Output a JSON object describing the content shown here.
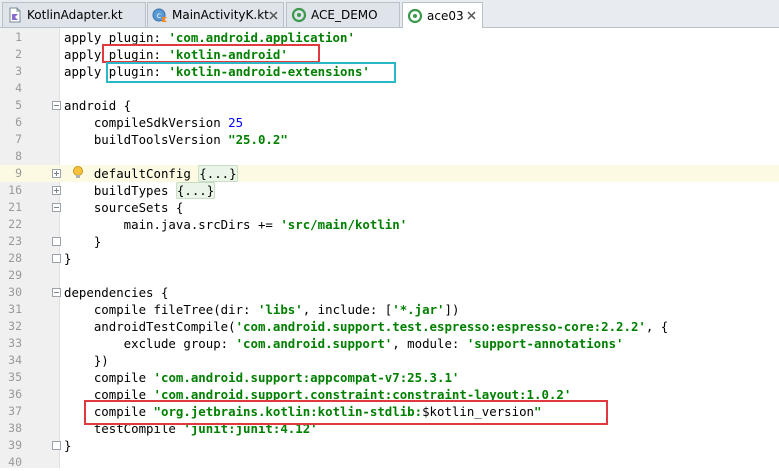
{
  "tabs": [
    {
      "label": "KotlinAdapter.kt",
      "icon": "kotlin-file-icon",
      "active": false
    },
    {
      "label": "MainActivityK.kt",
      "icon": "kotlin-class-icon",
      "active": false
    },
    {
      "label": "ACE_DEMO",
      "icon": "android-module-icon",
      "active": false
    },
    {
      "label": "ace03",
      "icon": "android-module-icon",
      "active": true
    }
  ],
  "close_glyph": "×",
  "colors": {
    "red_highlight": "#e0393e",
    "cyan_highlight": "#2ab8c8",
    "string": "#008000",
    "number": "#0000ff",
    "keyword": "#000000"
  },
  "lines": [
    {
      "num": "1",
      "segments": [
        {
          "t": "apply plugin: "
        },
        {
          "t": "'com.android.application'",
          "c": "str"
        }
      ]
    },
    {
      "num": "2",
      "segments": [
        {
          "t": "apply plugin: "
        },
        {
          "t": "'kotlin-android'",
          "c": "str"
        }
      ]
    },
    {
      "num": "3",
      "segments": [
        {
          "t": "apply "
        },
        {
          "t": "plugin: "
        },
        {
          "t": "'kotlin-android-extensions'",
          "c": "str"
        }
      ]
    },
    {
      "num": "4",
      "segments": []
    },
    {
      "num": "5",
      "segments": [
        {
          "t": "android {"
        }
      ]
    },
    {
      "num": "6",
      "segments": [
        {
          "t": "    compileSdkVersion "
        },
        {
          "t": "25",
          "c": "num"
        }
      ]
    },
    {
      "num": "7",
      "segments": [
        {
          "t": "    buildToolsVersion "
        },
        {
          "t": "\"25.0.2\"",
          "c": "str"
        }
      ]
    },
    {
      "num": "8",
      "segments": []
    },
    {
      "num": "9",
      "segments": [
        {
          "t": "    defaultConfig "
        },
        {
          "t": "{...}",
          "c": "collapsed"
        }
      ]
    },
    {
      "num": "16",
      "segments": [
        {
          "t": "    buildTypes "
        },
        {
          "t": "{...}",
          "c": "collapsed"
        }
      ]
    },
    {
      "num": "21",
      "segments": [
        {
          "t": "    sourceSets {"
        }
      ]
    },
    {
      "num": "22",
      "segments": [
        {
          "t": "        main.java.srcDirs += "
        },
        {
          "t": "'src/main/kotlin'",
          "c": "str"
        }
      ]
    },
    {
      "num": "23",
      "segments": [
        {
          "t": "    }"
        }
      ]
    },
    {
      "num": "28",
      "segments": [
        {
          "t": "}"
        }
      ]
    },
    {
      "num": "29",
      "segments": []
    },
    {
      "num": "30",
      "segments": [
        {
          "t": "dependencies {"
        }
      ]
    },
    {
      "num": "31",
      "segments": [
        {
          "t": "    compile fileTree(dir: "
        },
        {
          "t": "'libs'",
          "c": "str"
        },
        {
          "t": ", include: ["
        },
        {
          "t": "'*.jar'",
          "c": "str"
        },
        {
          "t": "])"
        }
      ]
    },
    {
      "num": "32",
      "segments": [
        {
          "t": "    androidTestCompile("
        },
        {
          "t": "'com.android.support.test.espresso:espresso-core:2.2.2'",
          "c": "str"
        },
        {
          "t": ", {"
        }
      ]
    },
    {
      "num": "33",
      "segments": [
        {
          "t": "        exclude group: "
        },
        {
          "t": "'com.android.support'",
          "c": "str"
        },
        {
          "t": ", module: "
        },
        {
          "t": "'support-annotations'",
          "c": "str"
        }
      ]
    },
    {
      "num": "34",
      "segments": [
        {
          "t": "    })"
        }
      ]
    },
    {
      "num": "35",
      "segments": [
        {
          "t": "    compile "
        },
        {
          "t": "'com.android.support:appcompat-v7:25.3.1'",
          "c": "str"
        }
      ]
    },
    {
      "num": "36",
      "segments": [
        {
          "t": "    compile "
        },
        {
          "t": "'com.android.support.constraint:constraint-layout:1.0.2'",
          "c": "str"
        }
      ]
    },
    {
      "num": "37",
      "segments": [
        {
          "t": "    compile "
        },
        {
          "t": "\"org.jetbrains.kotlin:kotlin-stdlib:",
          "c": "str"
        },
        {
          "t": "$kotlin_version"
        },
        {
          "t": "\"",
          "c": "str"
        }
      ]
    },
    {
      "num": "38",
      "segments": [
        {
          "t": "    testCompile "
        },
        {
          "t": "'junit:junit:4.12'",
          "c": "str"
        }
      ]
    },
    {
      "num": "39",
      "segments": [
        {
          "t": "}"
        }
      ]
    },
    {
      "num": "40",
      "segments": []
    }
  ]
}
